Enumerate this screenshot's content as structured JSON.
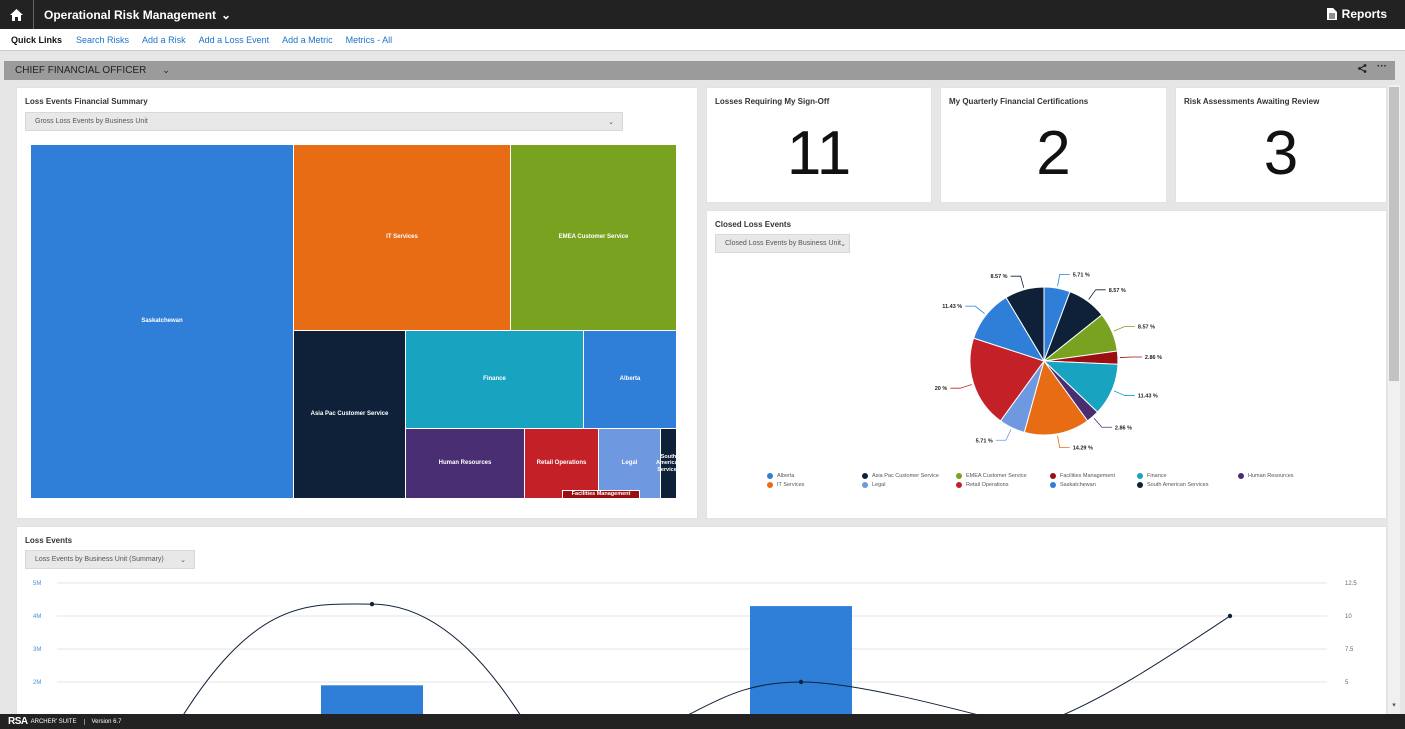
{
  "topbar": {
    "app_title": "Operational Risk Management",
    "reports_label": "Reports"
  },
  "quick_links": {
    "label": "Quick Links",
    "links": [
      "Search Risks",
      "Add a Risk",
      "Add a Loss Event",
      "Add a Metric",
      "Metrics - All"
    ]
  },
  "section": {
    "title": "CHIEF FINANCIAL OFFICER"
  },
  "treemap_panel": {
    "title": "Loss Events Financial Summary",
    "dropdown_value": "Gross Loss Events by Business Unit",
    "tiles": [
      {
        "label": "Saskatchewan",
        "color": "#2f7fd9"
      },
      {
        "label": "IT Services",
        "color": "#e86c14"
      },
      {
        "label": "EMEA Customer Service",
        "color": "#78a21f"
      },
      {
        "label": "Asia Pac Customer Service",
        "color": "#0f2138"
      },
      {
        "label": "Finance",
        "color": "#18a3c1"
      },
      {
        "label": "Alberta",
        "color": "#2f7fd9"
      },
      {
        "label": "Human Resources",
        "color": "#4a2e74"
      },
      {
        "label": "Retail Operations",
        "color": "#c32127"
      },
      {
        "label": "Legal",
        "color": "#6e98e0"
      },
      {
        "label": "South American Services",
        "color": "#0f2138"
      },
      {
        "label": "Facilities Management",
        "color": "#9a1010"
      }
    ]
  },
  "kpis": [
    {
      "title": "Losses Requiring My Sign-Off",
      "value": "11"
    },
    {
      "title": "My Quarterly Financial Certifications",
      "value": "2"
    },
    {
      "title": "Risk Assessments Awaiting Review",
      "value": "3"
    }
  ],
  "pie_panel": {
    "title": "Closed Loss Events",
    "dropdown_value": "Closed Loss Events by Business Unit",
    "slices": [
      {
        "name": "Alberta",
        "pct": 5.71,
        "label": "5.71 %",
        "color": "#2f7fd9"
      },
      {
        "name": "Asia Pac Customer Service",
        "pct": 8.57,
        "label": "8.57 %",
        "color": "#0f2138"
      },
      {
        "name": "EMEA Customer Service",
        "pct": 8.57,
        "label": "8.57 %",
        "color": "#78a21f"
      },
      {
        "name": "Facilities Management",
        "pct": 2.86,
        "label": "2.86 %",
        "color": "#9a1010"
      },
      {
        "name": "Finance",
        "pct": 11.43,
        "label": "11.43 %",
        "color": "#18a3c1"
      },
      {
        "name": "Human Resources",
        "pct": 2.86,
        "label": "2.86 %",
        "color": "#4a2e74"
      },
      {
        "name": "IT Services",
        "pct": 14.29,
        "label": "14.29 %",
        "color": "#e86c14"
      },
      {
        "name": "Legal",
        "pct": 5.71,
        "label": "5.71 %",
        "color": "#6e98e0"
      },
      {
        "name": "Retail Operations",
        "pct": 20,
        "label": "20 %",
        "color": "#c32127"
      },
      {
        "name": "Saskatchewan",
        "pct": 11.43,
        "label": "11.43 %",
        "color": "#2f7fd9"
      },
      {
        "name": "South American Services",
        "pct": 8.57,
        "label": "8.57 %",
        "color": "#0f2138"
      }
    ],
    "legend": [
      {
        "name": "Alberta",
        "color": "#2f7fd9"
      },
      {
        "name": "Asia Pac Customer Service",
        "color": "#0f2138"
      },
      {
        "name": "EMEA Customer Service",
        "color": "#78a21f"
      },
      {
        "name": "Facilities Management",
        "color": "#9a1010"
      },
      {
        "name": "Finance",
        "color": "#18a3c1"
      },
      {
        "name": "Human Resources",
        "color": "#4a2e74"
      },
      {
        "name": "IT Services",
        "color": "#e86c14"
      },
      {
        "name": "Legal",
        "color": "#6e98e0"
      },
      {
        "name": "Retail Operations",
        "color": "#c32127"
      },
      {
        "name": "Saskatchewan",
        "color": "#2f7fd9"
      },
      {
        "name": "South American Services",
        "color": "#0f2138"
      }
    ]
  },
  "loss_panel": {
    "title": "Loss Events",
    "dropdown_value": "Loss Events by Business Unit (Summary)",
    "left_ticks": [
      "5M",
      "4M",
      "3M",
      "2M"
    ],
    "right_ticks": [
      "12.5",
      "10",
      "7.5",
      "5"
    ]
  },
  "chart_data": [
    {
      "type": "pie",
      "title": "Closed Loss Events",
      "categories": [
        "Alberta",
        "Asia Pac Customer Service",
        "EMEA Customer Service",
        "Facilities Management",
        "Finance",
        "Human Resources",
        "IT Services",
        "Legal",
        "Retail Operations",
        "Saskatchewan",
        "South American Services"
      ],
      "values": [
        5.71,
        8.57,
        8.57,
        2.86,
        11.43,
        2.86,
        14.29,
        5.71,
        20,
        11.43,
        8.57
      ],
      "legend": "bottom"
    },
    {
      "type": "bar",
      "title": "Loss Events",
      "series": [
        {
          "type": "bar",
          "x": [
            2,
            5
          ],
          "values": [
            1.9,
            4.3
          ]
        },
        {
          "type": "line",
          "x": [
            2,
            5,
            8
          ],
          "values": [
            10.9,
            5,
            10
          ]
        }
      ],
      "y_left_range": [
        0,
        5
      ],
      "y_right_range": [
        0,
        12.5
      ],
      "grid": true
    }
  ],
  "footer": {
    "brand": "RSA",
    "suite": "ARCHER' SUITE",
    "version": "Version 6.7"
  },
  "colors": {
    "topbar": "#222222",
    "link": "#1b73c9",
    "section": "#9b9b9b",
    "bar": "#2f7fd9"
  }
}
